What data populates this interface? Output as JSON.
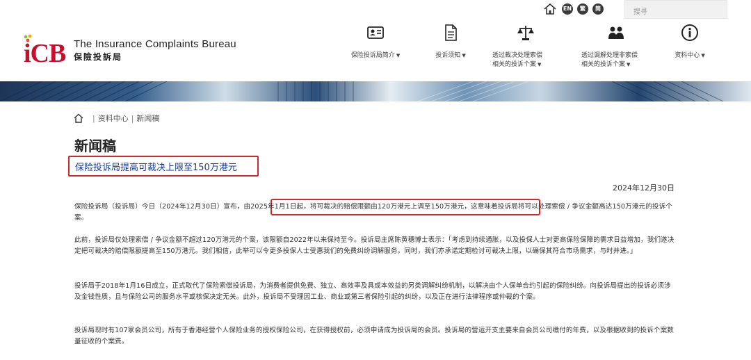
{
  "topbar": {
    "lang_en": "EN",
    "lang_tc": "繁",
    "lang_sc": "简",
    "search_placeholder": "搜寻"
  },
  "logo": {
    "mark": "iCB",
    "name_en": "The Insurance Complaints Bureau",
    "name_zh": "保險投訴局"
  },
  "nav": [
    {
      "icon": "id-card-icon",
      "label_1": "保险投诉局简介",
      "label_2": ""
    },
    {
      "icon": "document-icon",
      "label_1": "投诉须知",
      "label_2": ""
    },
    {
      "icon": "scales-icon",
      "label_1": "透过裁决处理索偿",
      "label_2": "相关的投诉个案"
    },
    {
      "icon": "people-icon",
      "label_1": "透过调解处理非索偿",
      "label_2": "相关的投诉个案"
    },
    {
      "icon": "info-icon",
      "label_1": "资料中心",
      "label_2": ""
    }
  ],
  "breadcrumb": {
    "item1": "资料中心",
    "item2": "新闻稿"
  },
  "page": {
    "title": "新闻稿",
    "headline": "保险投诉局提高可裁决上限至150万港元",
    "date": "2024年12月30日"
  },
  "paragraphs": {
    "p1_a": "保险投诉局（投诉局）今日（2024年12月30日）宣布，",
    "p1_hl": "由2025年1月1日起，将可裁决的赔偿限额由120万港元上调至150万港元，",
    "p1_b": "这意味着投诉局将可以处理索偿 / 争议金额高达150万港元的投诉个案。",
    "p2": "此前，投诉局仅处理索偿 / 争议金额不超过120万港元的个案，该限额自2022年以来保持至今。投诉局主席陈黄穗博士表示：「考虑到持续通胀，以及投保人士对更高保险保障的需求日益增加，我们遂决定把可裁决的赔偿限额提高至150万港元。我们相信，此举可以令更多投保人士受惠我们的免费纠纷调解服务。同时，我们亦承诺定期检讨可裁决上限，以确保其符合市场需求，与时并进。」",
    "p3": "投诉局于2018年1月16日成立，正式取代了保险索偿投诉局，为消费者提供免费、独立、高效率及具成本效益的另类调解纠纷机制，以解决由个人保单合约引起的保险纠纷。向投诉局提出的投诉必须涉及金钱性质，且与保险公司的服务水平或核保决定无关。此外，投诉局不受理因工业、商业或第三者保险引起的纠纷，以及正在进行法律程序或仲裁的个案。",
    "p4": "投诉局现时有107家会员公司，所有于香港经营个人保险业务的授权保险公司，在获得授权前，必须申请成为投诉局的会员。投诉局的营运开支主要来自会员公司缴付的年费，以及根据收到的投诉个案数量征收的个案费。"
  },
  "colors": {
    "accent_red": "#d62828",
    "headline_blue": "#1a3d8f",
    "logo_red": "#c8102e"
  }
}
